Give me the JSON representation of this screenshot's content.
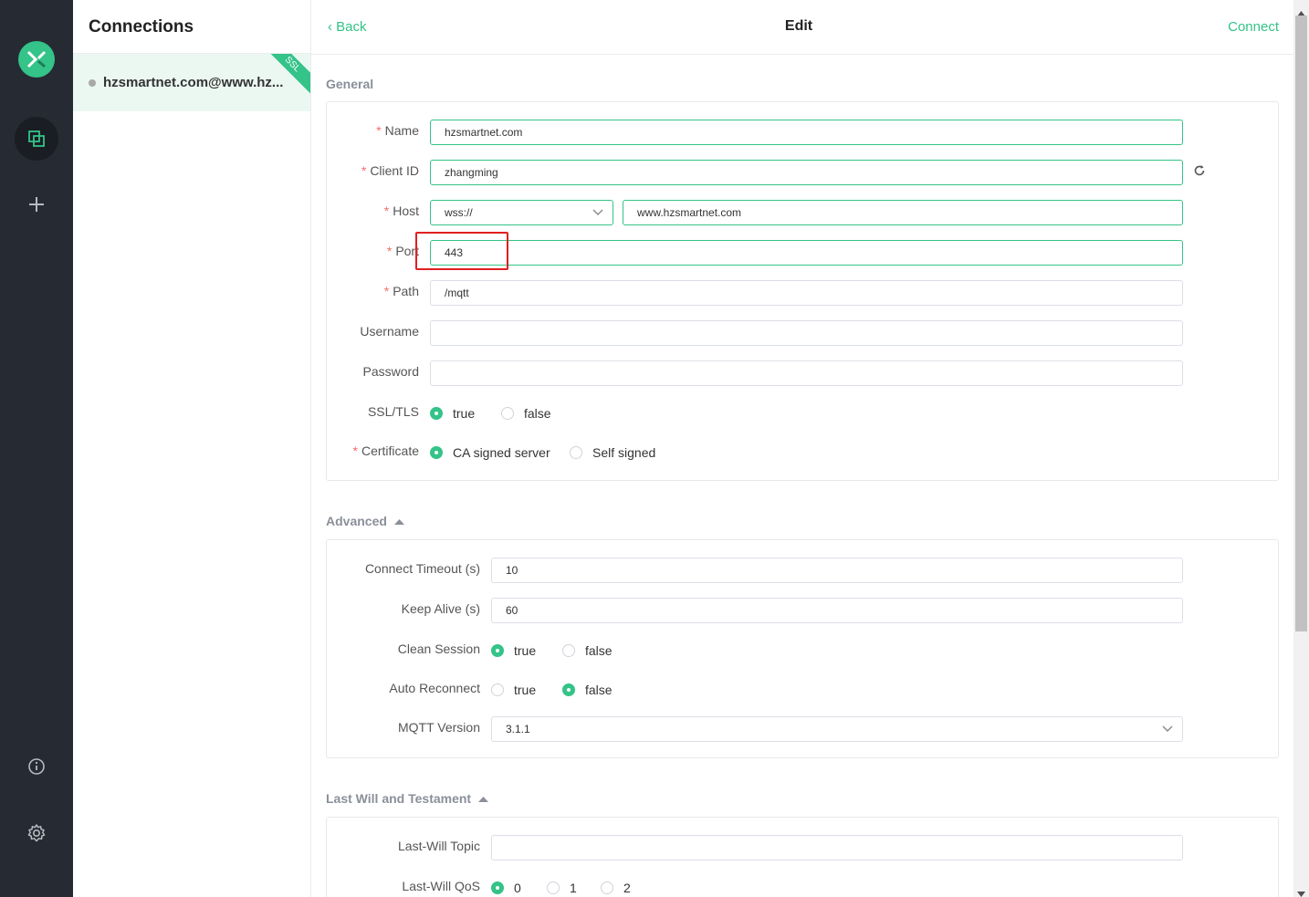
{
  "sidebar": {
    "icons": [
      "logo-icon",
      "connections-icon",
      "plus-icon",
      "info-icon",
      "gear-icon"
    ]
  },
  "connections": {
    "title": "Connections",
    "items": [
      {
        "name": "hzsmartnet.com@www.hz...",
        "badge": "SSL"
      }
    ]
  },
  "topbar": {
    "back": "Back",
    "title": "Edit",
    "connect": "Connect"
  },
  "general": {
    "title": "General",
    "name_label": "Name",
    "name_value": "hzsmartnet.com",
    "clientid_label": "Client ID",
    "clientid_value": "zhangming",
    "host_label": "Host",
    "protocol_value": "wss://",
    "host_value": "www.hzsmartnet.com",
    "port_label": "Port",
    "port_value": "443",
    "path_label": "Path",
    "path_value": "/mqtt",
    "username_label": "Username",
    "username_value": "",
    "password_label": "Password",
    "password_value": "",
    "ssl_label": "SSL/TLS",
    "ssl_true": "true",
    "ssl_false": "false",
    "cert_label": "Certificate",
    "cert_ca": "CA signed server",
    "cert_self": "Self signed"
  },
  "advanced": {
    "title": "Advanced",
    "timeout_label": "Connect Timeout (s)",
    "timeout_value": "10",
    "keepalive_label": "Keep Alive (s)",
    "keepalive_value": "60",
    "clean_label": "Clean Session",
    "clean_true": "true",
    "clean_false": "false",
    "reconnect_label": "Auto Reconnect",
    "reconnect_true": "true",
    "reconnect_false": "false",
    "version_label": "MQTT Version",
    "version_value": "3.1.1"
  },
  "lastwill": {
    "title": "Last Will and Testament",
    "topic_label": "Last-Will Topic",
    "topic_value": "",
    "qos_label": "Last-Will QoS",
    "qos_0": "0",
    "qos_1": "1",
    "qos_2": "2"
  },
  "colors": {
    "accent": "#34c388",
    "rail": "#262a33",
    "highlight": "#e02020"
  }
}
